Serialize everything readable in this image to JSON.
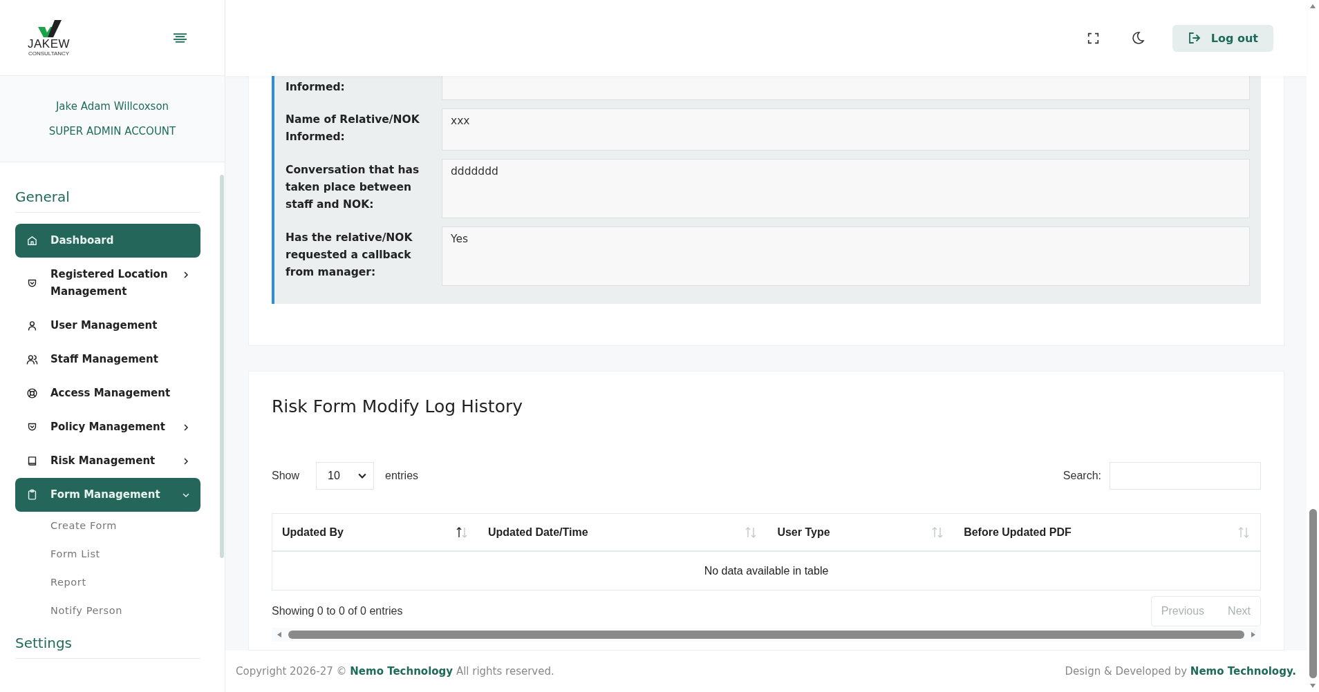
{
  "brand": {
    "name": "JAKEW",
    "tagline": "CONSULTANCY"
  },
  "profile": {
    "name": "Jake Adam Willcoxson",
    "role": "SUPER ADMIN ACCOUNT"
  },
  "sidebar": {
    "sections": [
      {
        "title": "General",
        "items": [
          {
            "label": "Dashboard",
            "selected": true,
            "has_submenu": false
          },
          {
            "label": "Registered Location Management",
            "selected": false,
            "has_submenu": true,
            "expanded": false
          },
          {
            "label": "User Management",
            "selected": false,
            "has_submenu": false
          },
          {
            "label": "Staff Management",
            "selected": false,
            "has_submenu": false
          },
          {
            "label": "Access Management",
            "selected": false,
            "has_submenu": false
          },
          {
            "label": "Policy Management",
            "selected": false,
            "has_submenu": true,
            "expanded": false
          },
          {
            "label": "Risk Management",
            "selected": false,
            "has_submenu": true,
            "expanded": false
          },
          {
            "label": "Form Management",
            "selected": true,
            "has_submenu": true,
            "expanded": true,
            "children": [
              {
                "label": "Create Form"
              },
              {
                "label": "Form List"
              },
              {
                "label": "Report"
              },
              {
                "label": "Notify Person"
              }
            ]
          }
        ]
      },
      {
        "title": "Settings"
      }
    ]
  },
  "header": {
    "logout": "Log out"
  },
  "form_fields": [
    {
      "label": "Informed:"
    },
    {
      "label": "Name of Relative/NOK Informed:",
      "value": "xxx"
    },
    {
      "label": "Conversation that has taken place between staff and NOK:",
      "value": "ddddddd"
    },
    {
      "label": "Has the relative/NOK requested a callback from manager:",
      "value": "Yes"
    }
  ],
  "log": {
    "title": "Risk Form Modify Log History",
    "show_label": "Show",
    "page_size": "10",
    "entries_label": "entries",
    "search_label": "Search:",
    "columns": [
      {
        "label": "Updated By",
        "sorted": true
      },
      {
        "label": "Updated Date/Time",
        "sorted": false
      },
      {
        "label": "User Type",
        "sorted": false
      },
      {
        "label": "Before Updated PDF",
        "sorted": false
      }
    ],
    "empty_message": "No data available in table",
    "info": "Showing 0 to 0 of 0 entries",
    "pagination": [
      {
        "label": "Previous",
        "disabled": true
      },
      {
        "label": "Next",
        "disabled": true
      }
    ]
  },
  "footer": {
    "copyright_prefix": "Copyright 2026-27 ©",
    "copyright_link": "Nemo Technology",
    "copyright_suffix": "All rights reserved.",
    "credit_prefix": "Design & Developed by",
    "credit_link": "Nemo Technology."
  }
}
